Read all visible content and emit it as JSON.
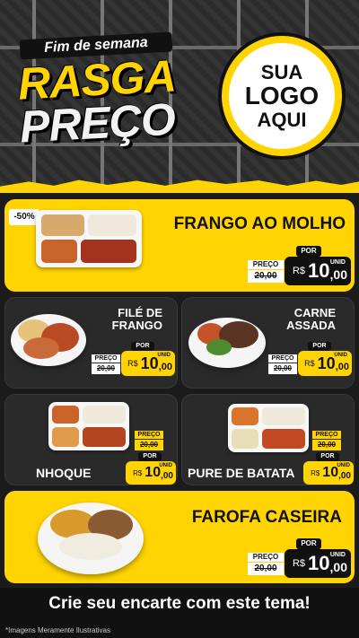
{
  "header": {
    "tagline": "Fim de semana",
    "title_line1": "RASGA",
    "title_line2": "PREÇO",
    "logo": {
      "line1": "SUA",
      "line2": "LOGO",
      "line3": "AQUI"
    }
  },
  "products": [
    {
      "name": "FRANGO AO MOLHO",
      "badge": "-50%",
      "label_old": "PREÇO",
      "label_new": "POR",
      "old_price": "20,00",
      "currency": "R$",
      "price_int": "10",
      "price_dec": ",00",
      "unit": "UNID"
    },
    {
      "name_line1": "FILÉ DE",
      "name_line2": "FRANGO",
      "label_old": "PREÇO",
      "label_new": "POR",
      "old_price": "20,00",
      "currency": "R$",
      "price_int": "10",
      "price_dec": ",00",
      "unit": "UNID"
    },
    {
      "name_line1": "CARNE",
      "name_line2": "ASSADA",
      "label_old": "PREÇO",
      "label_new": "POR",
      "old_price": "20,00",
      "currency": "R$",
      "price_int": "10",
      "price_dec": ",00",
      "unit": "UNID"
    },
    {
      "name": "NHOQUE",
      "label_old": "PREÇO",
      "label_new": "POR",
      "old_price": "20,00",
      "currency": "R$",
      "price_int": "10",
      "price_dec": ",00",
      "unit": "UNID"
    },
    {
      "name": "PURE DE BATATA",
      "label_old": "PREÇO",
      "label_new": "POR",
      "old_price": "20,00",
      "currency": "R$",
      "price_int": "10",
      "price_dec": ",00",
      "unit": "UNID"
    },
    {
      "name": "FAROFA CASEIRA",
      "label_old": "PREÇO",
      "label_new": "POR",
      "old_price": "20,00",
      "currency": "R$",
      "price_int": "10",
      "price_dec": ",00",
      "unit": "UNID"
    }
  ],
  "footer": {
    "cta": "Crie seu encarte com este tema!",
    "note": "*Imagens Meramente Ilustrativas"
  },
  "colors": {
    "accent": "#ffd400",
    "dark": "#111111",
    "card_dark": "#2a2a2a"
  }
}
